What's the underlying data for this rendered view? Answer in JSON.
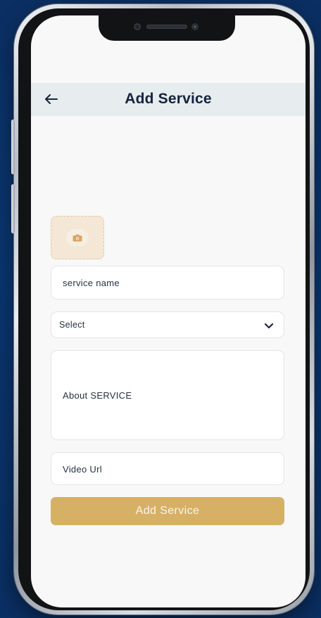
{
  "header": {
    "title": "Add Service",
    "back_icon": "arrow-left-icon"
  },
  "upload": {
    "icon": "camera-icon"
  },
  "form": {
    "service_name_placeholder": "service name",
    "category_select_value": "Select",
    "category_select_icon": "chevron-down-icon",
    "about_placeholder": "About SERVICE",
    "video_url_placeholder": "Video Url",
    "submit_label": "Add Service"
  },
  "colors": {
    "header_bg": "#e7ecef",
    "title": "#14233d",
    "accent": "#d6b064",
    "upload_bg": "#f4e7d6",
    "background": "#0b2f63"
  }
}
